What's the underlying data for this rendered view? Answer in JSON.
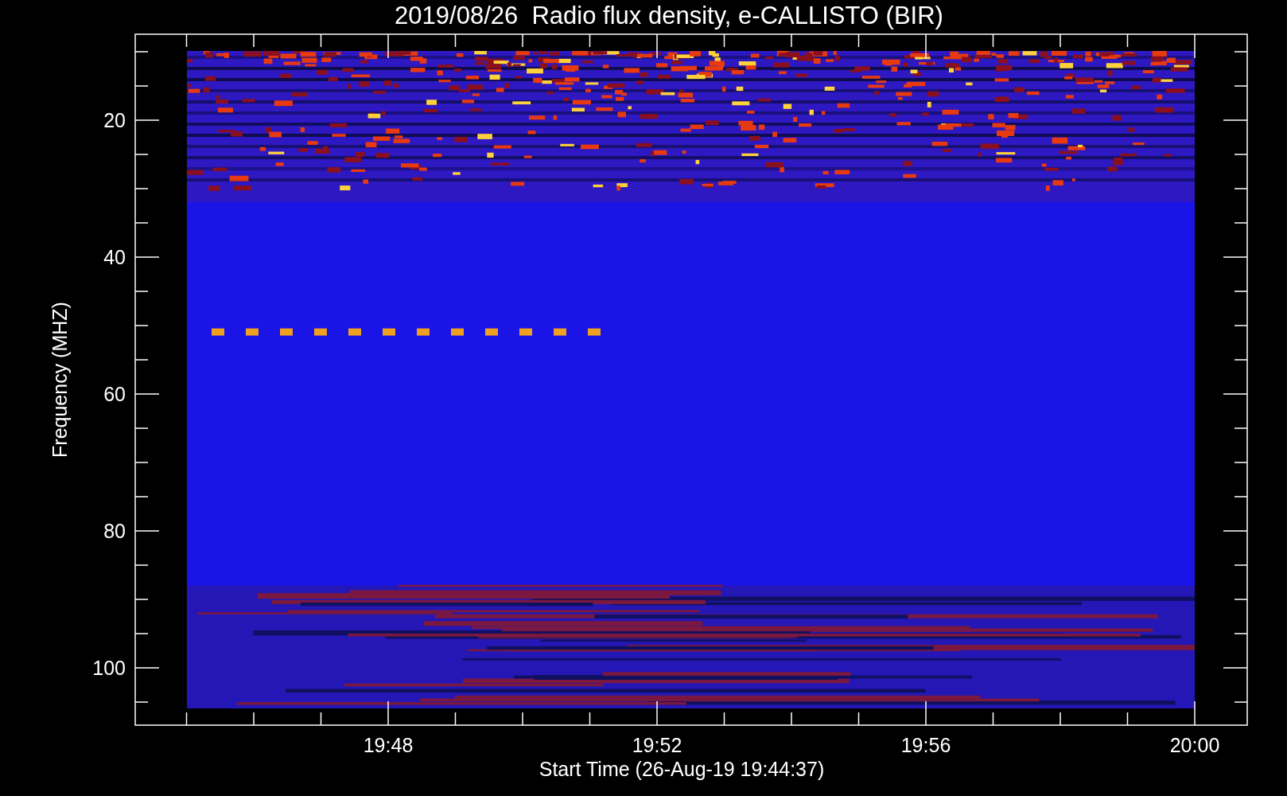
{
  "title": "2019/08/26  Radio flux density, e-CALLISTO (BIR)",
  "y_axis": {
    "label": "Frequency (MHZ)",
    "ticks": [
      "20",
      "40",
      "60",
      "80",
      "100"
    ]
  },
  "x_axis": {
    "label": "Start Time (26-Aug-19 19:44:37)",
    "ticks": [
      "19:48",
      "19:52",
      "19:56",
      "20:00"
    ]
  }
}
